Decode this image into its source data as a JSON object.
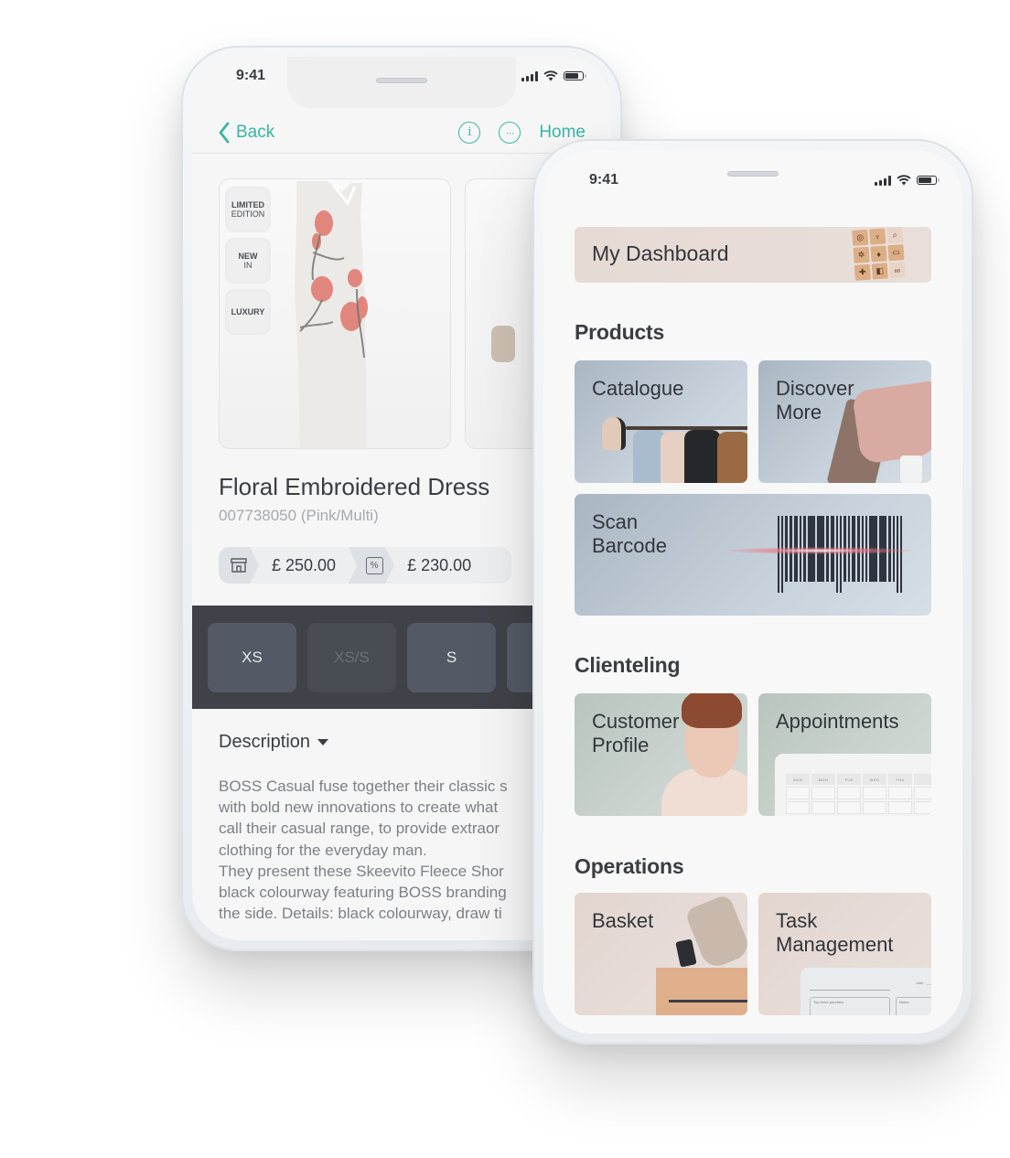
{
  "product_phone": {
    "status": {
      "time": "9:41"
    },
    "nav": {
      "back_label": "Back",
      "info_icon": "info-icon",
      "more_icon": "more-icon",
      "home_label": "Home"
    },
    "badges": [
      {
        "line1": "LIMITED",
        "line2": "EDITION"
      },
      {
        "line1": "NEW",
        "line2": "IN"
      },
      {
        "line1": "LUXURY",
        "line2": ""
      }
    ],
    "product": {
      "title": "Floral Embroidered Dress",
      "sku": "007738050 (Pink/Multi)",
      "price": "£ 250.00",
      "sale_price": "£ 230.00",
      "price_icon": "store-icon",
      "sale_icon": "percent-icon",
      "sale_icon_glyph": "%"
    },
    "sizes": [
      {
        "label": "XS",
        "available": true
      },
      {
        "label": "XS/S",
        "available": false
      },
      {
        "label": "S",
        "available": true
      },
      {
        "label": "",
        "available": true
      }
    ],
    "description": {
      "heading": "Description",
      "lines": [
        "BOSS Casual fuse together their classic s",
        "with bold new innovations to create what",
        "call their casual range, to provide extraor",
        "clothing for the everyday man.",
        "They present these Skeevito Fleece Shor",
        "black colourway featuring BOSS branding",
        "the side. Details: black colourway, draw ti"
      ]
    }
  },
  "dashboard_phone": {
    "status": {
      "time": "9:41"
    },
    "dashboard_card": {
      "label": "My Dashboard"
    },
    "sections": [
      {
        "title": "Products",
        "tiles": [
          {
            "label": "Catalogue"
          },
          {
            "label": "Discover More"
          },
          {
            "label": "Scan Barcode"
          }
        ]
      },
      {
        "title": "Clienteling",
        "tiles": [
          {
            "label": "Customer Profile"
          },
          {
            "label": "Appointments"
          }
        ]
      },
      {
        "title": "Operations",
        "tiles": [
          {
            "label": "Basket"
          },
          {
            "label": "Task Management"
          }
        ]
      }
    ],
    "calendar_days": [
      "SUN",
      "MON",
      "TUE",
      "WED",
      "THU"
    ],
    "planner": {
      "priorities_label": "Top three priorities",
      "notes_label": "Notes",
      "date_label": "date :  ___/___"
    }
  },
  "colors": {
    "accent": "#3ab6a4",
    "size_band": "#3f4248",
    "tile_blue": "#c8d2dc",
    "tile_sage": "#cbd4cf",
    "tile_rose": "#e6dcd8"
  }
}
